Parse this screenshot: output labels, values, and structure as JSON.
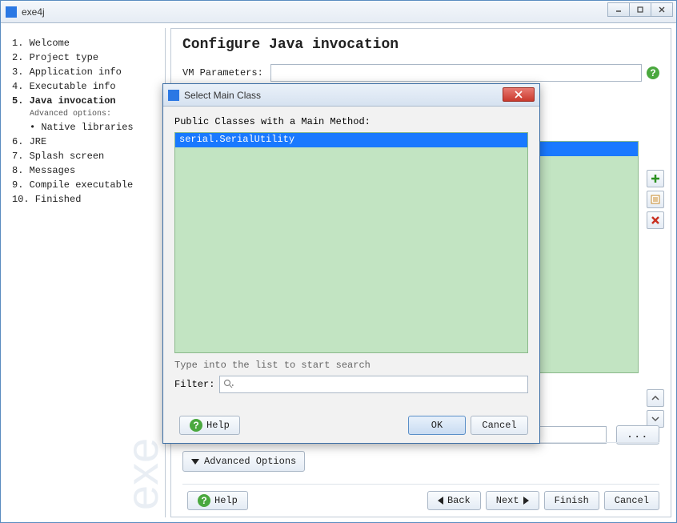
{
  "window": {
    "title": "exe4j"
  },
  "sidebar": {
    "steps": [
      "1.  Welcome",
      "2.  Project type",
      "3.  Application info",
      "4.  Executable info",
      "5.  Java invocation",
      "6.  JRE",
      "7.  Splash screen",
      "8.  Messages",
      "9.  Compile executable",
      "10. Finished"
    ],
    "active_index": 4,
    "advanced_label": "Advanced options:",
    "native_label": "• Native libraries"
  },
  "content": {
    "heading": "Configure Java invocation",
    "vm_params_label": "VM Parameters:",
    "vm_params_value": "",
    "advanced_button": "Advanced Options",
    "help_button": "Help",
    "back_button": "Back",
    "next_button": "Next",
    "finish_button": "Finish",
    "cancel_button": "Cancel",
    "browse_button": "..."
  },
  "dialog": {
    "title": "Select Main Class",
    "list_label": "Public Classes with a Main Method:",
    "list_items": [
      "serial.SerialUtility"
    ],
    "type_hint": "Type into the list to start search",
    "filter_label": "Filter:",
    "filter_value": "",
    "help_button": "Help",
    "ok_button": "OK",
    "cancel_button": "Cancel"
  }
}
